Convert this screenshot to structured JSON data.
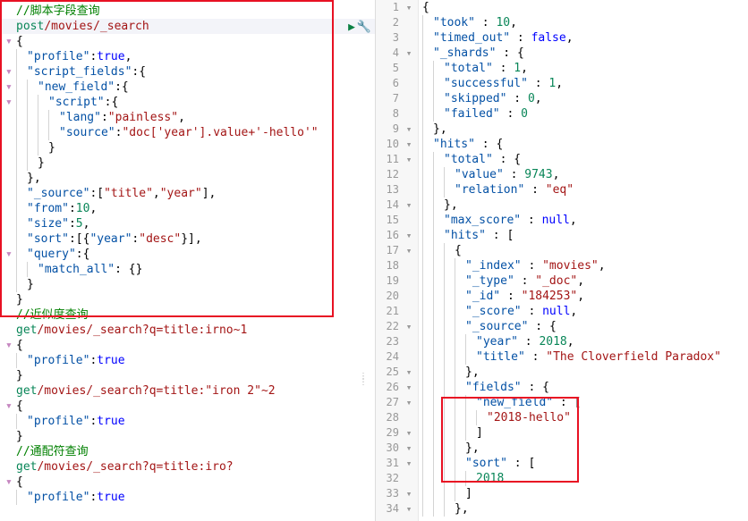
{
  "left": {
    "lines": [
      {
        "raw": "//脚本字段查询",
        "cls": "comment",
        "mark": ""
      },
      {
        "raw": "post /movies/_search",
        "cls": "request",
        "method": "post",
        "path": "/movies/_search"
      },
      {
        "raw": "{",
        "cls": "punc",
        "mark": "▾"
      },
      {
        "raw": "  \"profile\":true,",
        "cls": "kv"
      },
      {
        "raw": "  \"script_fields\":{",
        "cls": "kv",
        "mark": "▾"
      },
      {
        "raw": "    \"new_field\":{",
        "cls": "kv",
        "mark": "▾"
      },
      {
        "raw": "      \"script\":{",
        "cls": "kv",
        "mark": "▾"
      },
      {
        "raw": "        \"lang\":\"painless\",",
        "cls": "kv"
      },
      {
        "raw": "        \"source\":\"doc['year'].value+'-hello'\"",
        "cls": "kv"
      },
      {
        "raw": "      }",
        "cls": "punc"
      },
      {
        "raw": "    }",
        "cls": "punc"
      },
      {
        "raw": "  },",
        "cls": "punc"
      },
      {
        "raw": "  \"_source\":[\"title\",\"year\"],",
        "cls": "kv"
      },
      {
        "raw": "  \"from\":10,",
        "cls": "kv"
      },
      {
        "raw": "  \"size\":5,",
        "cls": "kv"
      },
      {
        "raw": "  \"sort\":[{\"year\":\"desc\"}],",
        "cls": "kv"
      },
      {
        "raw": "  \"query\":{",
        "cls": "kv",
        "mark": "▾"
      },
      {
        "raw": "    \"match_all\": {}",
        "cls": "kv"
      },
      {
        "raw": "  }",
        "cls": "punc"
      },
      {
        "raw": "}",
        "cls": "punc"
      },
      {
        "raw": "",
        "cls": ""
      },
      {
        "raw": "//近似度查询",
        "cls": "comment"
      },
      {
        "raw": "get /movies/_search?q=title:irno~1",
        "cls": "request2",
        "method": "get",
        "path": "/movies/_search?q=title:irno~1"
      },
      {
        "raw": "{",
        "cls": "punc",
        "mark": "▾"
      },
      {
        "raw": "  \"profile\":true",
        "cls": "kv"
      },
      {
        "raw": "}",
        "cls": "punc"
      },
      {
        "raw": "get /movies/_search?q=title:\"iron 2\"~2",
        "cls": "request2",
        "method": "get",
        "path": "/movies/_search?q=title:\"iron 2\"~2"
      },
      {
        "raw": "{",
        "cls": "punc",
        "mark": "▾"
      },
      {
        "raw": "  \"profile\":true",
        "cls": "kv"
      },
      {
        "raw": "}",
        "cls": "punc"
      },
      {
        "raw": "//通配符查询",
        "cls": "comment"
      },
      {
        "raw": "get /movies/_search?q=title:iro?",
        "cls": "request2",
        "method": "get",
        "path": "/movies/_search?q=title:iro?"
      },
      {
        "raw": "{",
        "cls": "punc",
        "mark": "▾"
      },
      {
        "raw": "  \"profile\":true",
        "cls": "kv"
      }
    ]
  },
  "right": {
    "lines": [
      {
        "n": 1,
        "fold": "▾",
        "t": "{"
      },
      {
        "n": 2,
        "fold": "",
        "t": "  \"took\" : 10,"
      },
      {
        "n": 3,
        "fold": "",
        "t": "  \"timed_out\" : false,"
      },
      {
        "n": 4,
        "fold": "▾",
        "t": "  \"_shards\" : {"
      },
      {
        "n": 5,
        "fold": "",
        "t": "    \"total\" : 1,"
      },
      {
        "n": 6,
        "fold": "",
        "t": "    \"successful\" : 1,"
      },
      {
        "n": 7,
        "fold": "",
        "t": "    \"skipped\" : 0,"
      },
      {
        "n": 8,
        "fold": "",
        "t": "    \"failed\" : 0"
      },
      {
        "n": 9,
        "fold": "▾",
        "t": "  },"
      },
      {
        "n": 10,
        "fold": "▾",
        "t": "  \"hits\" : {"
      },
      {
        "n": 11,
        "fold": "▾",
        "t": "    \"total\" : {"
      },
      {
        "n": 12,
        "fold": "",
        "t": "      \"value\" : 9743,"
      },
      {
        "n": 13,
        "fold": "",
        "t": "      \"relation\" : \"eq\""
      },
      {
        "n": 14,
        "fold": "▾",
        "t": "    },"
      },
      {
        "n": 15,
        "fold": "",
        "t": "    \"max_score\" : null,"
      },
      {
        "n": 16,
        "fold": "▾",
        "t": "    \"hits\" : ["
      },
      {
        "n": 17,
        "fold": "▾",
        "t": "      {"
      },
      {
        "n": 18,
        "fold": "",
        "t": "        \"_index\" : \"movies\","
      },
      {
        "n": 19,
        "fold": "",
        "t": "        \"_type\" : \"_doc\","
      },
      {
        "n": 20,
        "fold": "",
        "t": "        \"_id\" : \"184253\","
      },
      {
        "n": 21,
        "fold": "",
        "t": "        \"_score\" : null,"
      },
      {
        "n": 22,
        "fold": "▾",
        "t": "        \"_source\" : {"
      },
      {
        "n": 23,
        "fold": "",
        "t": "          \"year\" : 2018,"
      },
      {
        "n": 24,
        "fold": "",
        "t": "          \"title\" : \"The Cloverfield Paradox\""
      },
      {
        "n": 25,
        "fold": "▾",
        "t": "        },"
      },
      {
        "n": 26,
        "fold": "▾",
        "t": "        \"fields\" : {"
      },
      {
        "n": 27,
        "fold": "▾",
        "t": "          \"new_field\" : ["
      },
      {
        "n": 28,
        "fold": "",
        "t": "            \"2018-hello\""
      },
      {
        "n": 29,
        "fold": "▾",
        "t": "          ]"
      },
      {
        "n": 30,
        "fold": "▾",
        "t": "        },"
      },
      {
        "n": 31,
        "fold": "▾",
        "t": "        \"sort\" : ["
      },
      {
        "n": 32,
        "fold": "",
        "t": "          2018"
      },
      {
        "n": 33,
        "fold": "▾",
        "t": "        ]"
      },
      {
        "n": 34,
        "fold": "▾",
        "t": "      },"
      }
    ]
  }
}
